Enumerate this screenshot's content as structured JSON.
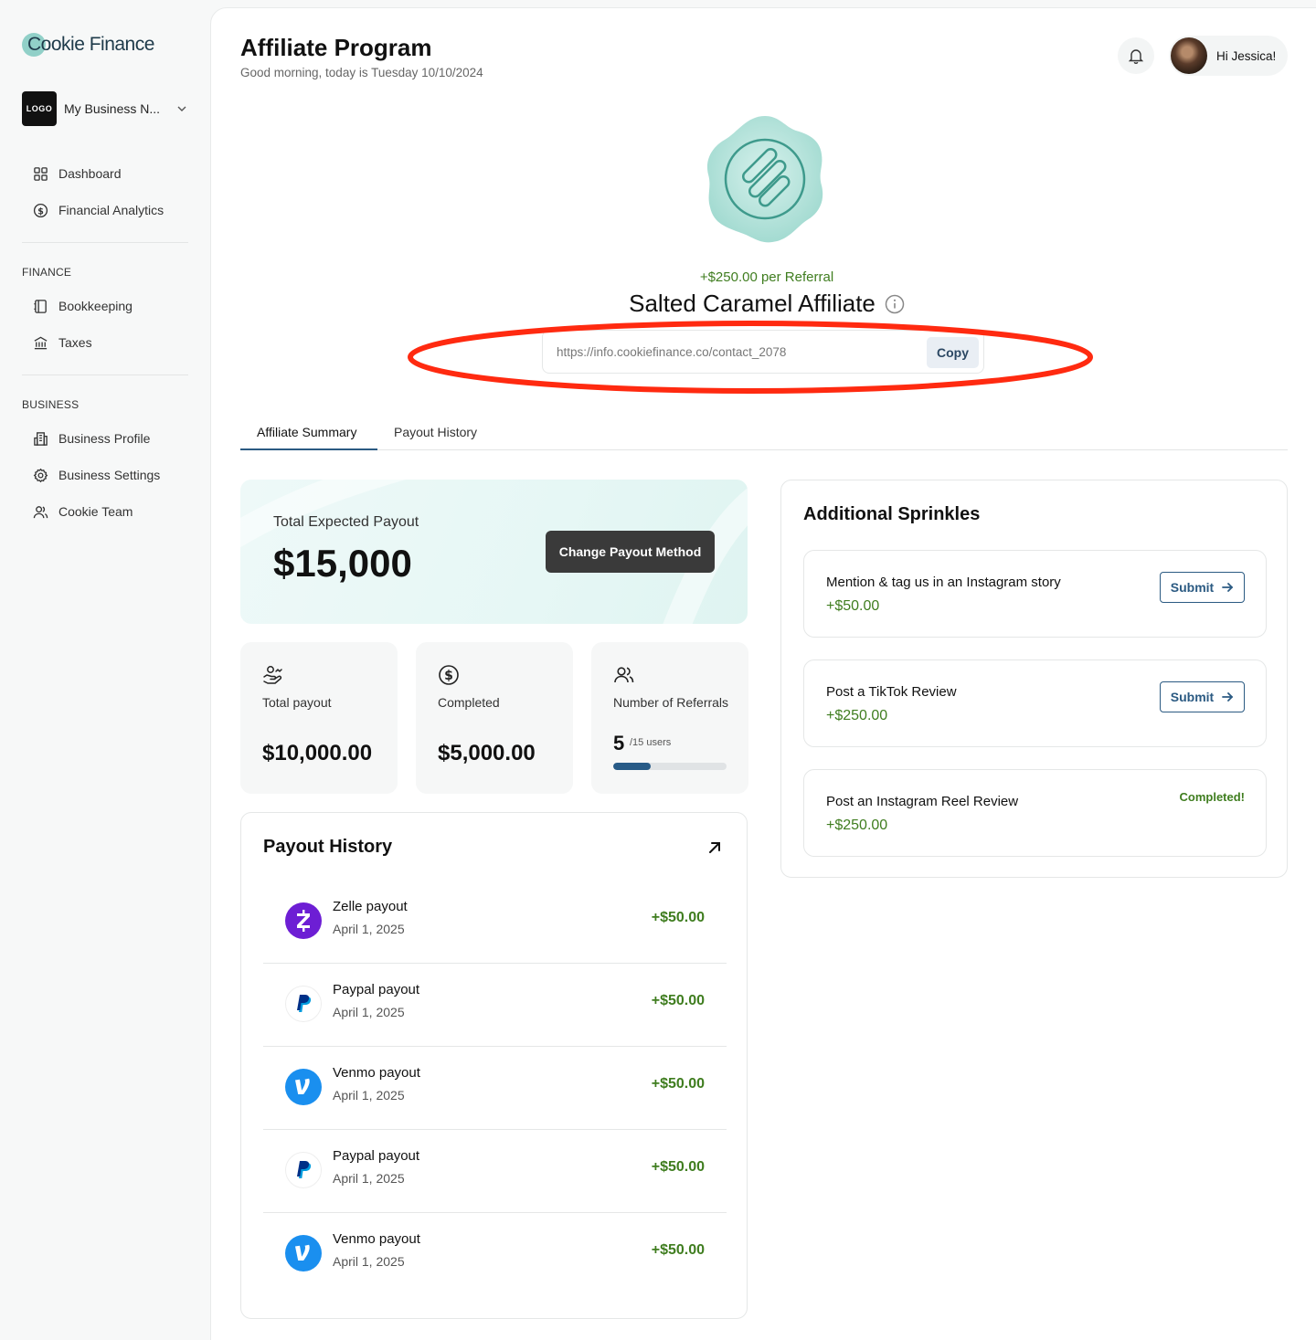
{
  "brand": {
    "name": "Cookie Finance"
  },
  "business": {
    "logo_text": "LOGO",
    "name": "My Business N..."
  },
  "nav": {
    "top": [
      {
        "label": "Dashboard",
        "icon": "grid-icon"
      },
      {
        "label": "Financial Analytics",
        "icon": "dollar-circle-icon"
      }
    ],
    "finance_section": "FINANCE",
    "finance": [
      {
        "label": "Bookkeeping",
        "icon": "ledger-icon"
      },
      {
        "label": "Taxes",
        "icon": "bank-icon"
      }
    ],
    "business_section": "BUSINESS",
    "business": [
      {
        "label": "Business Profile",
        "icon": "building-icon"
      },
      {
        "label": "Business Settings",
        "icon": "gear-icon"
      },
      {
        "label": "Cookie Team",
        "icon": "users-icon"
      }
    ]
  },
  "header": {
    "title": "Affiliate Program",
    "subtitle": "Good morning, today is Tuesday 10/10/2024",
    "user_greeting": "Hi Jessica!"
  },
  "affiliate": {
    "per_referral": "+$250.00 per Referral",
    "tier_name": "Salted Caramel Affiliate",
    "link": "https://info.cookiefinance.co/contact_2078",
    "copy_label": "Copy"
  },
  "tabs": [
    {
      "label": "Affiliate Summary",
      "active": true
    },
    {
      "label": "Payout History",
      "active": false
    }
  ],
  "summary": {
    "expected_label": "Total Expected Payout",
    "expected_value": "$15,000",
    "change_button": "Change Payout Method",
    "total_payout_label": "Total payout",
    "total_payout_value": "$10,000.00",
    "completed_label": "Completed",
    "completed_value": "$5,000.00",
    "referrals_label": "Number of Referrals",
    "referrals_count": "5",
    "referrals_of": "/15 users",
    "referrals_progress": 0.333
  },
  "payout_history": {
    "title": "Payout History",
    "rows": [
      {
        "name": "Zelle payout",
        "date": "April 1, 2025",
        "amount": "+$50.00",
        "icon": "zelle-icon"
      },
      {
        "name": "Paypal payout",
        "date": "April 1, 2025",
        "amount": "+$50.00",
        "icon": "paypal-icon"
      },
      {
        "name": "Venmo payout",
        "date": "April 1, 2025",
        "amount": "+$50.00",
        "icon": "venmo-icon"
      },
      {
        "name": "Paypal payout",
        "date": "April 1, 2025",
        "amount": "+$50.00",
        "icon": "paypal-icon"
      },
      {
        "name": "Venmo payout",
        "date": "April 1, 2025",
        "amount": "+$50.00",
        "icon": "venmo-icon"
      }
    ]
  },
  "sprinkles": {
    "title": "Additional Sprinkles",
    "items": [
      {
        "name": "Mention & tag us in an Instagram story",
        "amount": "+$50.00",
        "action": "Submit"
      },
      {
        "name": "Post a TikTok Review",
        "amount": "+$250.00",
        "action": "Submit"
      },
      {
        "name": "Post an Instagram Reel Review",
        "amount": "+$250.00",
        "status": "Completed!"
      }
    ]
  },
  "colors": {
    "accent": "#2b5a82",
    "money_green": "#3f7d1f",
    "annotation_red": "#ff2a10",
    "zelle": "#6d1ed4",
    "venmo": "#1a8fef"
  }
}
